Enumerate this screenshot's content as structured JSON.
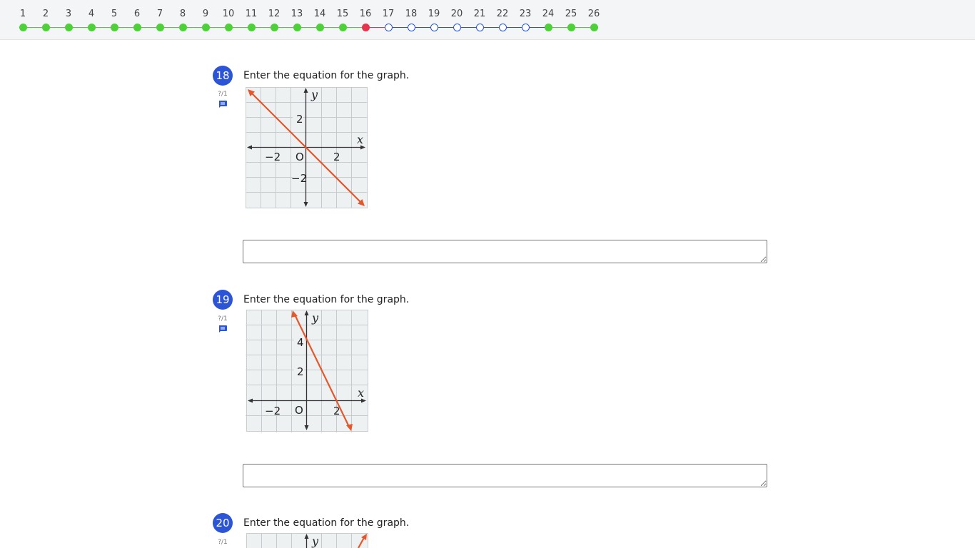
{
  "colors": {
    "accent": "#2b54d6",
    "complete": "#4cd137",
    "current": "#e8344e",
    "pending_border": "#2b54d6",
    "graph_line": "#e3572b"
  },
  "navigator": {
    "items": [
      {
        "label": "1",
        "status": "complete"
      },
      {
        "label": "2",
        "status": "complete"
      },
      {
        "label": "3",
        "status": "complete"
      },
      {
        "label": "4",
        "status": "complete"
      },
      {
        "label": "5",
        "status": "complete"
      },
      {
        "label": "6",
        "status": "complete"
      },
      {
        "label": "7",
        "status": "complete"
      },
      {
        "label": "8",
        "status": "complete"
      },
      {
        "label": "9",
        "status": "complete"
      },
      {
        "label": "10",
        "status": "complete"
      },
      {
        "label": "11",
        "status": "complete"
      },
      {
        "label": "12",
        "status": "complete"
      },
      {
        "label": "13",
        "status": "complete"
      },
      {
        "label": "14",
        "status": "complete"
      },
      {
        "label": "15",
        "status": "complete"
      },
      {
        "label": "16",
        "status": "current"
      },
      {
        "label": "17",
        "status": "unanswered"
      },
      {
        "label": "18",
        "status": "unanswered"
      },
      {
        "label": "19",
        "status": "unanswered"
      },
      {
        "label": "20",
        "status": "unanswered"
      },
      {
        "label": "21",
        "status": "unanswered"
      },
      {
        "label": "22",
        "status": "unanswered"
      },
      {
        "label": "23",
        "status": "unanswered"
      },
      {
        "label": "24",
        "status": "complete"
      },
      {
        "label": "25",
        "status": "complete"
      },
      {
        "label": "26",
        "status": "complete"
      }
    ]
  },
  "questions": [
    {
      "number": "18",
      "score": "?/1",
      "comment_icon": "comment-icon",
      "prompt": "Enter the equation for the graph.",
      "answer_value": "",
      "graph": {
        "x_label": "x",
        "y_label": "y",
        "tick_labels": {
          "x_neg": "−2",
          "origin": "O",
          "x_pos": "2",
          "y_pos": "2",
          "y_neg": "−2"
        },
        "x_range": [
          -4,
          4
        ],
        "y_range": [
          -4,
          4
        ],
        "line_points": [
          [
            -4,
            4
          ],
          [
            4,
            -4
          ]
        ]
      }
    },
    {
      "number": "19",
      "score": "?/1",
      "comment_icon": "comment-icon",
      "prompt": "Enter the equation for the graph.",
      "answer_value": "",
      "graph": {
        "x_label": "x",
        "y_label": "y",
        "tick_labels": {
          "x_neg": "−2",
          "origin": "O",
          "x_pos": "2",
          "y_pos_1": "2",
          "y_pos_2": "4"
        },
        "x_range": [
          -4,
          4
        ],
        "y_range": [
          -2,
          6
        ],
        "line_points": [
          [
            -1,
            6
          ],
          [
            3,
            -2
          ]
        ]
      }
    },
    {
      "number": "20",
      "score": "?/1",
      "prompt": "Enter the equation for the graph.",
      "graph": {
        "y_label": "y"
      }
    }
  ]
}
